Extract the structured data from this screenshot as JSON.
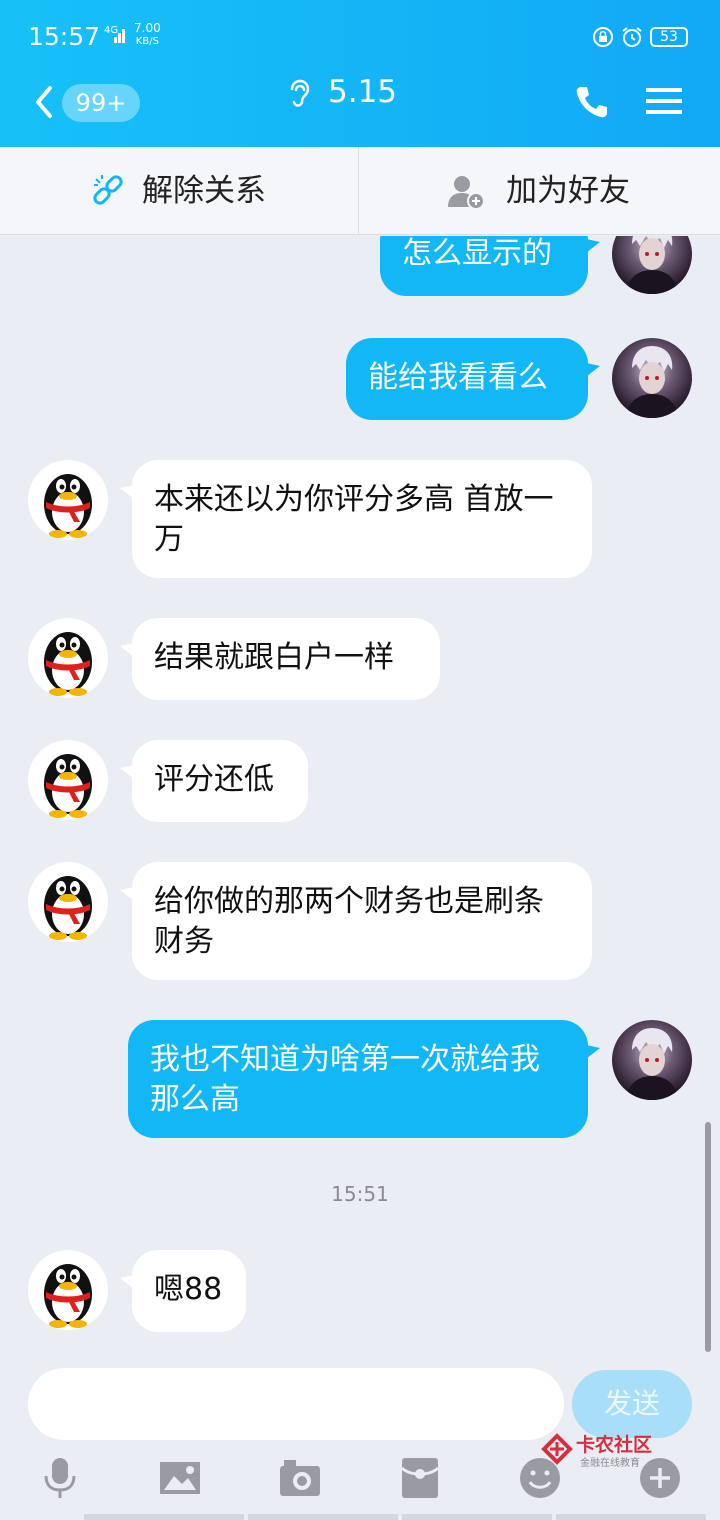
{
  "status_bar": {
    "time": "15:57",
    "network": "4G",
    "speed_value": "7.00",
    "speed_unit": "KB/S",
    "battery": "53"
  },
  "header": {
    "badge": "99+",
    "title": "5.15"
  },
  "actions": {
    "unbind_label": "解除关系",
    "add_friend_label": "加为好友"
  },
  "messages": [
    {
      "from": "me",
      "text": "怎么显示的"
    },
    {
      "from": "me",
      "text": "能给我看看么"
    },
    {
      "from": "other",
      "text": "本来还以为你评分多高 首放一万"
    },
    {
      "from": "other",
      "text": "结果就跟白户一样"
    },
    {
      "from": "other",
      "text": "评分还低"
    },
    {
      "from": "other",
      "text": "给你做的那两个财务也是刷条财务"
    },
    {
      "from": "me",
      "text": "我也不知道为啥第一次就给我那么高"
    },
    {
      "from": "timestamp",
      "text": "15:51"
    },
    {
      "from": "other",
      "text": "嗯88"
    }
  ],
  "input": {
    "placeholder": "",
    "send_label": "发送"
  },
  "toolbar": [
    "microphone-icon",
    "image-icon",
    "camera-icon",
    "red-packet-icon",
    "emoji-icon",
    "plus-icon"
  ],
  "watermark": {
    "title": "卡农社区",
    "subtitle": "金融在线教育"
  },
  "colors": {
    "header": "#12b7f5",
    "outgoing_bubble": "#12b7f5",
    "incoming_bubble": "#ffffff",
    "background": "#ebedf5"
  }
}
